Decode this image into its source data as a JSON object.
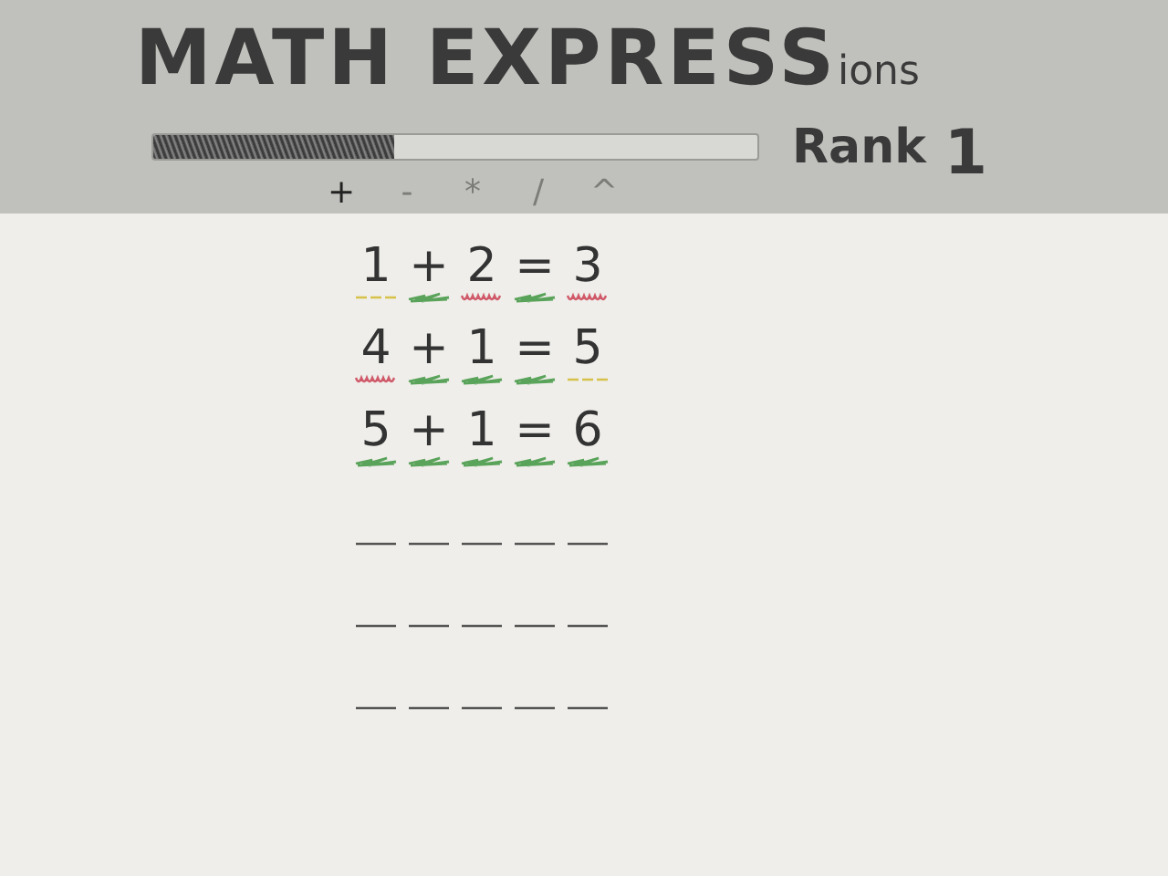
{
  "title": {
    "main": "MATH EXPRESS",
    "tail": "ions"
  },
  "progress": {
    "level": 0.4
  },
  "rank": {
    "label": "Rank",
    "value": "1"
  },
  "operators": [
    {
      "label": "+",
      "disabled": false
    },
    {
      "label": "-",
      "disabled": true
    },
    {
      "label": "*",
      "disabled": true
    },
    {
      "label": "/",
      "disabled": true
    },
    {
      "label": "^",
      "disabled": true
    }
  ],
  "rows": [
    {
      "cells": [
        {
          "char": "1",
          "kind": "present"
        },
        {
          "char": "+",
          "kind": "correct"
        },
        {
          "char": "2",
          "kind": "absent"
        },
        {
          "char": "=",
          "kind": "correct"
        },
        {
          "char": "3",
          "kind": "absent"
        }
      ]
    },
    {
      "cells": [
        {
          "char": "4",
          "kind": "absent"
        },
        {
          "char": "+",
          "kind": "correct"
        },
        {
          "char": "1",
          "kind": "correct"
        },
        {
          "char": "=",
          "kind": "correct"
        },
        {
          "char": "5",
          "kind": "present"
        }
      ]
    },
    {
      "cells": [
        {
          "char": "5",
          "kind": "correct"
        },
        {
          "char": "+",
          "kind": "correct"
        },
        {
          "char": "1",
          "kind": "correct"
        },
        {
          "char": "=",
          "kind": "correct"
        },
        {
          "char": "6",
          "kind": "correct"
        }
      ]
    },
    {
      "cells": [
        {
          "kind": "blank"
        },
        {
          "kind": "blank"
        },
        {
          "kind": "blank"
        },
        {
          "kind": "blank"
        },
        {
          "kind": "blank"
        }
      ]
    },
    {
      "cells": [
        {
          "kind": "blank"
        },
        {
          "kind": "blank"
        },
        {
          "kind": "blank"
        },
        {
          "kind": "blank"
        },
        {
          "kind": "blank"
        }
      ]
    },
    {
      "cells": [
        {
          "kind": "blank"
        },
        {
          "kind": "blank"
        },
        {
          "kind": "blank"
        },
        {
          "kind": "blank"
        },
        {
          "kind": "blank"
        }
      ]
    }
  ]
}
